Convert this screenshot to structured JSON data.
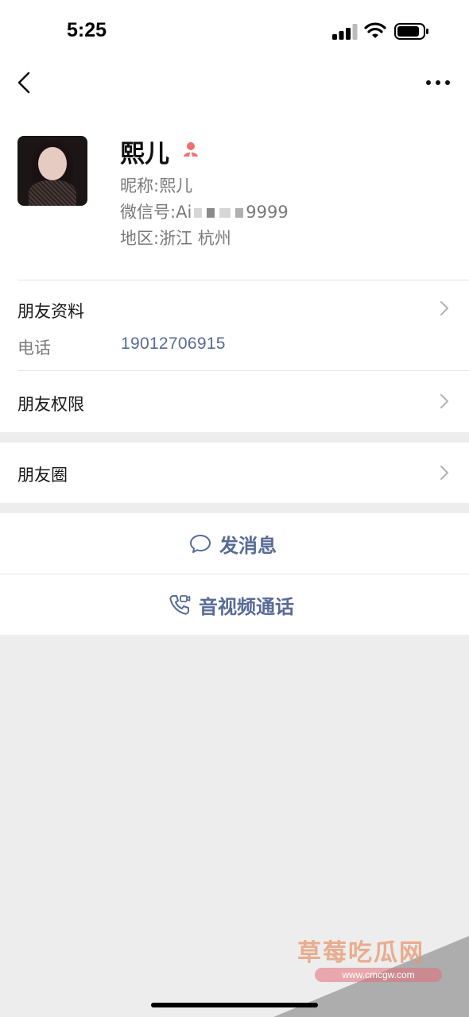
{
  "status_bar": {
    "time": "5:25"
  },
  "profile": {
    "name": "熙儿",
    "nickname_label": "昵称:",
    "nickname": "熙儿",
    "wechat_id_label": "微信号:",
    "wechat_id_start": "Ai",
    "wechat_id_end": "9999",
    "region_label": "地区:",
    "region": "浙江 杭州"
  },
  "friend_info": {
    "title": "朋友资料",
    "phone_label": "电话",
    "phone": "19012706915"
  },
  "friend_permissions": {
    "title": "朋友权限"
  },
  "moments": {
    "title": "朋友圈"
  },
  "actions": {
    "message": "发消息",
    "call": "音视频通话"
  },
  "watermark": {
    "text": "草莓吃瓜网",
    "url": "www.cmcgw.com"
  },
  "colors": {
    "link": "#576b95",
    "background": "#ededed",
    "gender_female": "#f07070"
  }
}
